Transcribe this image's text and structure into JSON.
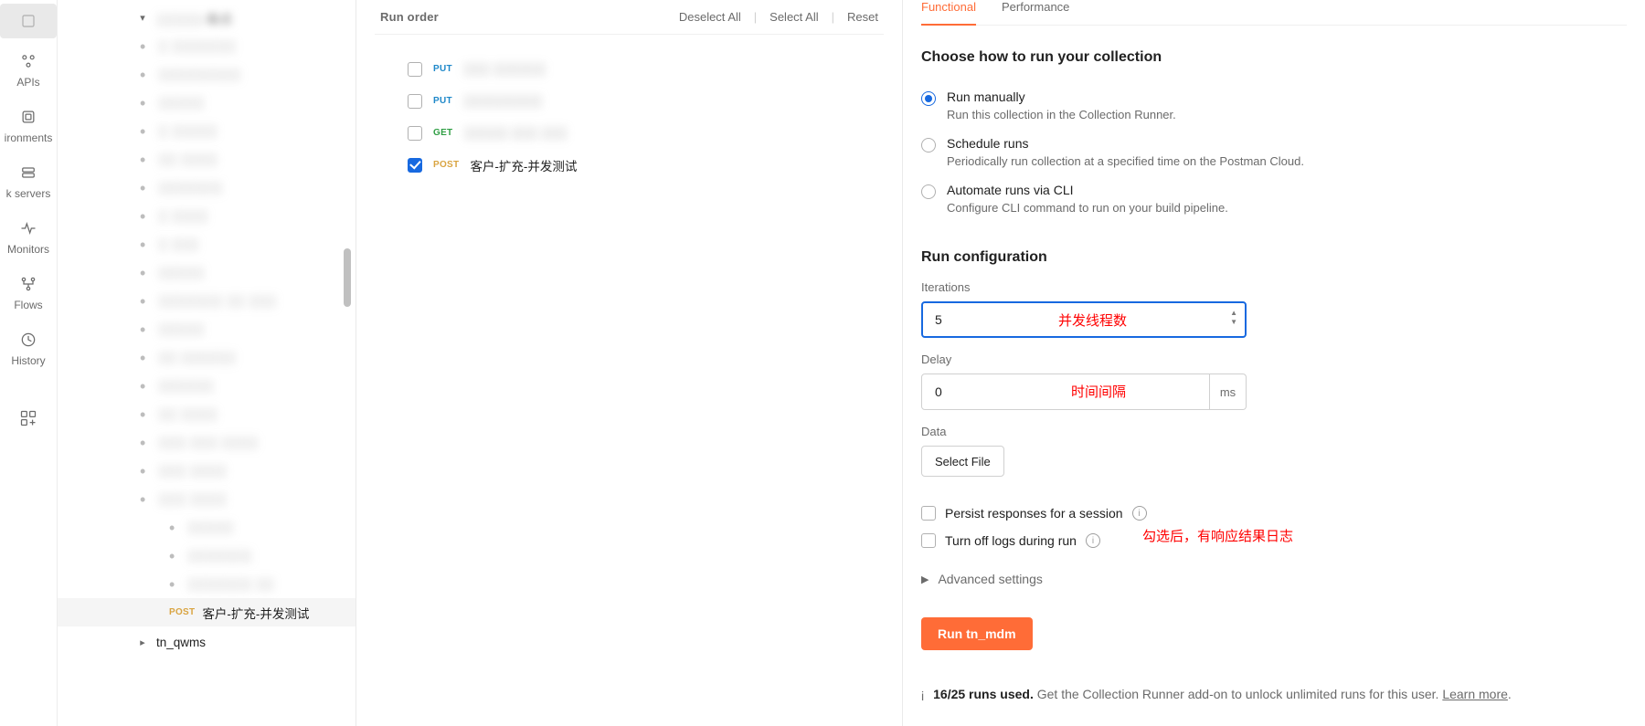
{
  "rail": {
    "items": [
      {
        "label": "APIs"
      },
      {
        "label": "ironments"
      },
      {
        "label": "k servers"
      },
      {
        "label": "Monitors"
      },
      {
        "label": "Flows"
      },
      {
        "label": "History"
      }
    ]
  },
  "sidebar": {
    "top_folder_label": "░░░░░-集成",
    "blurred_items": [
      "░ ░░░░░░░",
      "░░░░░░░░░",
      "░░░░░",
      "░ ░░░░░",
      "░░ ░░░░",
      "░░░░░░░",
      "░ ░░░░",
      "░ ░░░",
      "░░░░░",
      "░░░░░░░ ░░ ░░░",
      "░░░░░",
      "░░ ░░░░░░",
      "░░░░░░",
      "░░ ░░░░",
      "░░░ ░░░ ░░░░",
      "░░░ ░░░░",
      "░░░ ░░░░"
    ],
    "nested_blurred": [
      "░░░░░",
      "░░░░░░░",
      "░░░░░░░ ░░"
    ],
    "selected_request": {
      "method": "POST",
      "label": "客户-扩充-并发测试"
    },
    "bottom_folder": "tn_qwms"
  },
  "mid": {
    "title": "Run order",
    "actions": [
      "Deselect All",
      "Select All",
      "Reset"
    ],
    "items": [
      {
        "checked": false,
        "method": "PUT",
        "label": "░░░ ░░░░░░"
      },
      {
        "checked": false,
        "method": "PUT",
        "label": "░░░░░░░░░"
      },
      {
        "checked": false,
        "method": "GET",
        "label": "░░░░░ ░░░ ░░░"
      },
      {
        "checked": true,
        "method": "POST",
        "label": "客户-扩充-并发测试"
      }
    ]
  },
  "conf": {
    "tabs": {
      "active": "Functional",
      "other": "Performance"
    },
    "how_heading": "Choose how to run your collection",
    "options": [
      {
        "selected": true,
        "label": "Run manually",
        "desc": "Run this collection in the Collection Runner."
      },
      {
        "selected": false,
        "label": "Schedule runs",
        "desc": "Periodically run collection at a specified time on the Postman Cloud."
      },
      {
        "selected": false,
        "label": "Automate runs via CLI",
        "desc": "Configure CLI command to run on your build pipeline."
      }
    ],
    "run_config_heading": "Run configuration",
    "iterations_label": "Iterations",
    "iterations_value": "5",
    "delay_label": "Delay",
    "delay_value": "0",
    "delay_unit": "ms",
    "data_label": "Data",
    "select_file_label": "Select File",
    "persist_label": "Persist responses for a session",
    "turn_off_logs_label": "Turn off logs during run",
    "advanced_label": "Advanced settings",
    "run_button": "Run tn_mdm",
    "footer_bold": "16/25 runs used.",
    "footer_text": " Get the Collection Runner add-on to unlock unlimited runs for this user. ",
    "footer_link": "Learn more"
  },
  "callouts": {
    "iterations": "并发线程数",
    "delay": "时间间隔",
    "persist": "勾选后，有响应结果日志"
  }
}
